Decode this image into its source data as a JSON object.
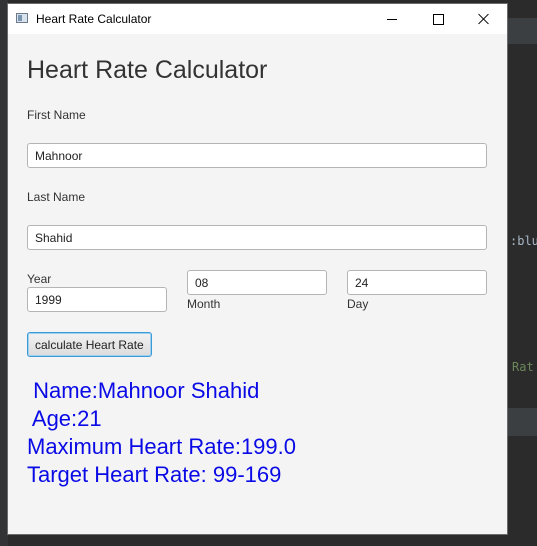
{
  "window": {
    "title": "Heart Rate Calculator"
  },
  "form": {
    "heading": "Heart Rate Calculator",
    "first_name_label": "First Name",
    "first_name_value": "Mahnoor",
    "last_name_label": "Last Name",
    "last_name_value": "Shahid",
    "year_label": "Year",
    "year_value": "1999",
    "month_label": "Month",
    "month_value": "08",
    "day_label": "Day",
    "day_value": "24",
    "calculate_label": "calculate Heart Rate"
  },
  "results": {
    "name": " Name:Mahnoor Shahid",
    "age": " Age:21",
    "max_rate": "Maximum Heart Rate:199.0",
    "target_rate": "Target Heart Rate: 99-169"
  },
  "background": {
    "code_fragment_1": ":blu",
    "code_fragment_2": "Rat"
  },
  "colors": {
    "result_text": "#0a0ae6",
    "button_focus_border": "#3c9ad6"
  }
}
